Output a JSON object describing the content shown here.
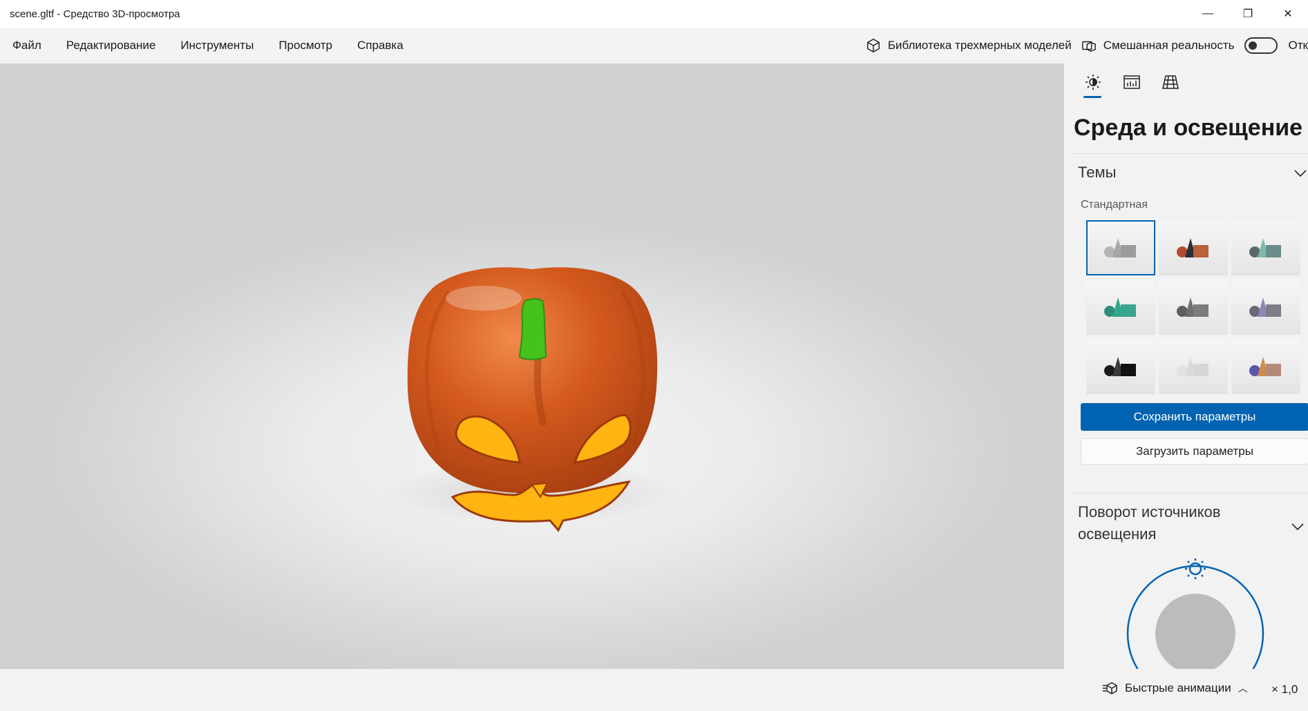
{
  "window": {
    "title": "scene.gltf - Средство 3D-просмотра",
    "minimize_glyph": "—",
    "restore_glyph": "❐",
    "close_glyph": "✕"
  },
  "menu": {
    "items": [
      "Файл",
      "Редактирование",
      "Инструменты",
      "Просмотр",
      "Справка"
    ],
    "library_label": "Библиотека трехмерных моделей",
    "mixed_reality_label": "Смешанная реальность",
    "toggle_state_label": "Отк"
  },
  "panel": {
    "tabs": [
      "lighting-icon",
      "stats-icon",
      "grid-icon"
    ],
    "title": "Среда и освещение",
    "themes_section": "Темы",
    "themes_sublabel": "Стандартная",
    "save_button": "Сохранить параметры",
    "load_button": "Загрузить параметры",
    "rotation_section": "Поворот источников освещения"
  },
  "status": {
    "animations_label": "Быстрые анимации",
    "speed_label": "× 1,0"
  },
  "colors": {
    "accent": "#0063b1",
    "pumpkin": "#d4561c",
    "stem": "#46c21d",
    "glow": "#ffb412"
  }
}
